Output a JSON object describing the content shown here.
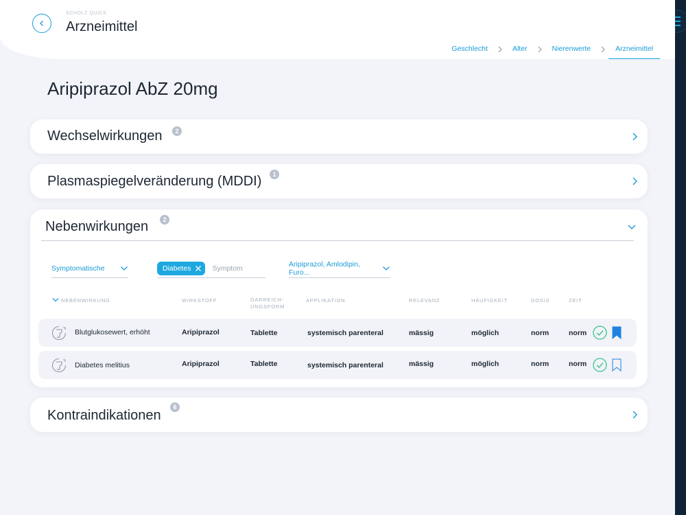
{
  "header": {
    "brand": "SCHOLZ QUICK",
    "title": "Arzneimittel",
    "breadcrumb": [
      {
        "label": "Geschlecht",
        "active": false
      },
      {
        "label": "Alter",
        "active": false
      },
      {
        "label": "Nierenwerte",
        "active": false
      },
      {
        "label": "Arzneimittel",
        "active": true
      }
    ]
  },
  "page_title": "Aripiprazol AbZ 20mg",
  "sections": {
    "wechselwirkungen": {
      "title": "Wechselwirkungen",
      "count": "2"
    },
    "plasma": {
      "title": "Plasmaspiegelveränderung (MDDI)",
      "count": "1"
    },
    "nebenwirkungen": {
      "title": "Nebenwirkungen",
      "count": "2"
    },
    "kontraindikationen": {
      "title": "Kontraindikationen",
      "count": "6"
    }
  },
  "filters": {
    "category": "Symptomatische",
    "chip": "Diabetes",
    "symptom_placeholder": "Symptom",
    "drugs": "Aripiprazol, Amlodipin, Furo..."
  },
  "columns": {
    "nebenwirkung": "NEBENWIRKUNG",
    "wirkstoff": "WIRKSTOFF",
    "darreichungsform_1": "DARREICH-",
    "darreichungsform_2": "UNGSFORM",
    "applikation": "APPLIKATION",
    "relevanz": "RELEVANZ",
    "haeufigkeit": "HÄUFIGKEIT",
    "dosis": "DOSIS",
    "zeit": "ZEIT"
  },
  "rows": [
    {
      "nebenwirkung": "Blutglukosewert, erhöht",
      "wirkstoff": "Aripiprazol",
      "darreichungsform": "Tablette",
      "applikation": "systemisch parenteral",
      "relevanz": "mässig",
      "haeufigkeit": "möglich",
      "dosis": "norm",
      "zeit": "norm",
      "bookmarked": true
    },
    {
      "nebenwirkung": "Diabetes melitius",
      "wirkstoff": "Aripiprazol",
      "darreichungsform": "Tablette",
      "applikation": "systemisch parenteral",
      "relevanz": "mässig",
      "haeufigkeit": "möglich",
      "dosis": "norm",
      "zeit": "norm",
      "bookmarked": false
    }
  ],
  "colors": {
    "accent": "#1a9bd7",
    "check": "#3cc48e",
    "bookmark": "#1f82e0",
    "sidebar": "#0f2236"
  },
  "icons": {
    "back": "chevron-left-icon",
    "menu": "hamburger-menu-icon",
    "row": "digestion-icon",
    "check": "check-circle-icon",
    "bookmark": "bookmark-icon"
  }
}
